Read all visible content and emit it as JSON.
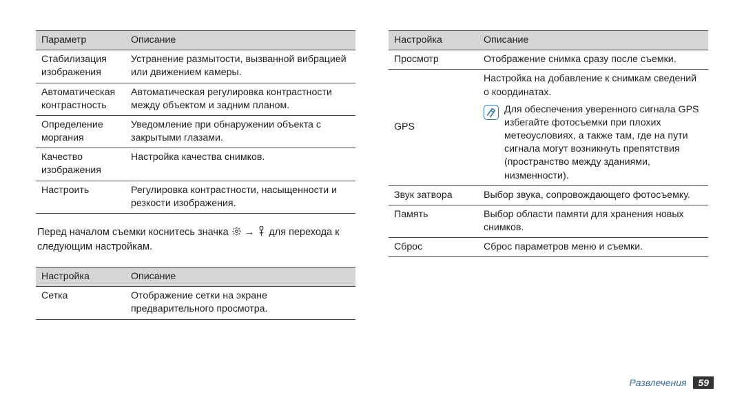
{
  "leftTable1": {
    "headers": [
      "Параметр",
      "Описание"
    ],
    "rows": [
      [
        "Стабилизация изображения",
        "Устранение размытости, вызванной вибрацией или движением камеры."
      ],
      [
        "Автоматическая контрастность",
        "Автоматическая регулировка контрастности между объектом и задним планом."
      ],
      [
        "Определение моргания",
        "Уведомление при обнаружении объекта с закрытыми глазами."
      ],
      [
        "Качество изображения",
        "Настройка качества снимков."
      ],
      [
        "Настроить",
        "Регулировка контрастности, насыщенности и резкости изображения."
      ]
    ]
  },
  "gear_icon_name": "settings-gear-icon",
  "tool_icon_name": "settings-tool-icon",
  "para": {
    "pre": "Перед началом съемки коснитесь значка ",
    "arrow": " → ",
    "post": " для перехода к следующим настройкам."
  },
  "leftTable2": {
    "headers": [
      "Настройка",
      "Описание"
    ],
    "rows": [
      [
        "Сетка",
        "Отображение сетки на экране предварительного просмотра."
      ]
    ]
  },
  "rightTable": {
    "headers": [
      "Настройка",
      "Описание"
    ],
    "rows": [
      {
        "c0": "Просмотр",
        "c1": "Отображение снимка сразу после съемки."
      },
      {
        "c0": "GPS",
        "c1_main": "Настройка на добавление к снимкам сведений о координатах.",
        "note_icon_name": "note-info-icon",
        "note": "Для обеспечения уверенного сигнала GPS избегайте фотосъемки при плохих метеоусловиях, а также там, где на пути сигнала могут возникнуть препятствия (пространство между зданиями, низменности)."
      },
      {
        "c0": "Звук затвора",
        "c1": "Выбор звука, сопровождающего фотосъемку."
      },
      {
        "c0": "Память",
        "c1": "Выбор области памяти для хранения новых снимков."
      },
      {
        "c0": "Сброс",
        "c1": "Сброс параметров меню и съемки."
      }
    ]
  },
  "footer": {
    "section": "Развлечения",
    "page": "59"
  }
}
